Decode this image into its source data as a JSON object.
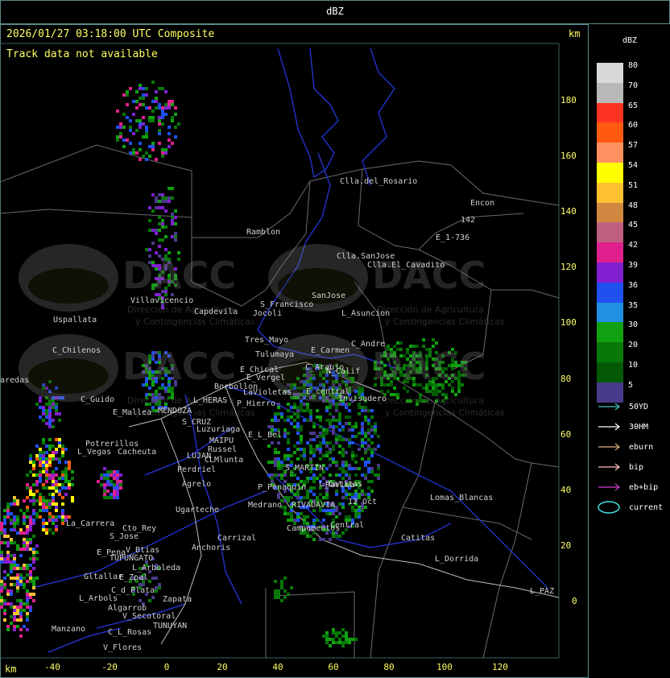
{
  "header": {
    "title": "dBZ"
  },
  "map": {
    "timestamp": "2026/01/27 03:18:00 UTC Composite",
    "track_message": "Track data not available",
    "unit_label_top": "km",
    "unit_label_bottom": "km",
    "y_ticks": [
      "180",
      "160",
      "140",
      "120",
      "100",
      "80",
      "60",
      "40",
      "20",
      "0"
    ],
    "x_ticks": [
      "-40",
      "-20",
      "0",
      "20",
      "40",
      "60",
      "80",
      "100",
      "120"
    ],
    "watermark": {
      "name": "DACC",
      "line1": "Dirección de Agricultura",
      "line2": "y Contingencias Climáticas"
    },
    "places": [
      "Clla.del_Rosario",
      "Encon",
      "142",
      "E_1-736",
      "Ramblon",
      "Clla.SanJose",
      "Clla.El_Cavadito",
      "Villavicencio",
      "S_Francisco",
      "SanJose",
      "Capdevila",
      "Jocoli",
      "L_Asuncion",
      "Uspallata",
      "Tres_Mayo",
      "C_Andre",
      "C_Chilenos",
      "Tulumaya",
      "E_Carmen",
      "E_Chical",
      "C_Araujo",
      "N_Calif",
      "aredas",
      "E_Vergel",
      "Borbollon",
      "E_central",
      "Invisadero",
      "LaVioletas",
      "L_HERAS",
      "P_Hierro",
      "C_Guido",
      "E_Mallea",
      "MENDOZA",
      "S_CRUZ",
      "Luzuriaga",
      "E_L_Bel",
      "MAIPU",
      "Russel",
      "Potrerillos",
      "L_Vegas",
      "Cacheuta",
      "LUJAN",
      "CLMlunta",
      "Perdriel",
      "S_MARTIN",
      "Agrelo",
      "P_Penaquin",
      "Ugarteche",
      "RIVADAVIA",
      "12_Oct",
      "L_Catitas",
      "Lomas_Blancas",
      "Medrano",
      "Cto_Rey",
      "La_Carrera",
      "S_Jose",
      "Carrizal",
      "Campamentos",
      "Central",
      "Catitas",
      "E_Pena",
      "V_Btias",
      "Anchoris",
      "TUPUNGATO",
      "L_Dorrida",
      "L_Arboleda",
      "Gltallar",
      "E_Zpal",
      "C_d_Plata",
      "L_Arbols",
      "Zapata",
      "L_PAZ",
      "Algarrob",
      "V_Secotoral",
      "TUNUYAN",
      "Manzano",
      "C_L_Rosas",
      "V_Flores",
      "Ravisa"
    ]
  },
  "legend": {
    "title": "dBZ",
    "scale": [
      {
        "label": "80",
        "color": "#d8d8d8"
      },
      {
        "label": "70",
        "color": "#b8b8b8"
      },
      {
        "label": "65",
        "color": "#ff3322"
      },
      {
        "label": "60",
        "color": "#ff5a10"
      },
      {
        "label": "57",
        "color": "#ff9060"
      },
      {
        "label": "54",
        "color": "#ffff00"
      },
      {
        "label": "51",
        "color": "#ffc030"
      },
      {
        "label": "48",
        "color": "#d08840"
      },
      {
        "label": "45",
        "color": "#c06080"
      },
      {
        "label": "42",
        "color": "#e0208c"
      },
      {
        "label": "39",
        "color": "#8020d0"
      },
      {
        "label": "36",
        "color": "#2050f0"
      },
      {
        "label": "35",
        "color": "#2090e0"
      },
      {
        "label": "30",
        "color": "#10a010"
      },
      {
        "label": "20",
        "color": "#087808"
      },
      {
        "label": "10",
        "color": "#045a04"
      },
      {
        "label": "5",
        "color": "#4a3a8a"
      }
    ],
    "tracks": [
      {
        "label": "50YD",
        "color": "#40c0c0"
      },
      {
        "label": "30HM",
        "color": "#ffffff"
      },
      {
        "label": "eburn",
        "color": "#e0b080"
      },
      {
        "label": "bip",
        "color": "#ffc0c0"
      },
      {
        "label": "eb+bip",
        "color": "#d040d0"
      },
      {
        "label": "current",
        "color": "#40e0e0"
      }
    ]
  }
}
